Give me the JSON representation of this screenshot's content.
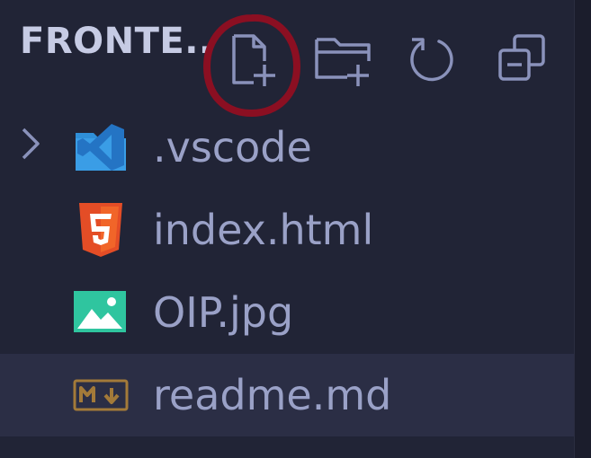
{
  "explorer": {
    "folder_title": "FRONTE..",
    "toolbar": [
      {
        "name": "new-file",
        "icon": "new-file-icon"
      },
      {
        "name": "new-folder",
        "icon": "new-folder-icon"
      },
      {
        "name": "refresh",
        "icon": "refresh-icon"
      },
      {
        "name": "collapse-all",
        "icon": "collapse-all-icon"
      }
    ],
    "annotation": {
      "shape": "circle",
      "color": "#8b0f22",
      "target": "new-file"
    },
    "files": [
      {
        "name": ".vscode",
        "icon": "vscode-folder-icon",
        "type": "folder",
        "collapsed": true
      },
      {
        "name": "index.html",
        "icon": "html5-icon",
        "type": "file"
      },
      {
        "name": "OIP.jpg",
        "icon": "image-icon",
        "type": "file"
      },
      {
        "name": "readme.md",
        "icon": "markdown-icon",
        "type": "file",
        "selected": true
      }
    ]
  },
  "colors": {
    "background": "#212436",
    "selected_row": "#2b2e45",
    "text": "#9aa1c7",
    "title": "#c6cbe4",
    "icon": "#8a92bb",
    "html5": "#e44d26",
    "image": "#2fc59f",
    "vscode": "#2f8fd8",
    "markdown": "#a37a39"
  }
}
